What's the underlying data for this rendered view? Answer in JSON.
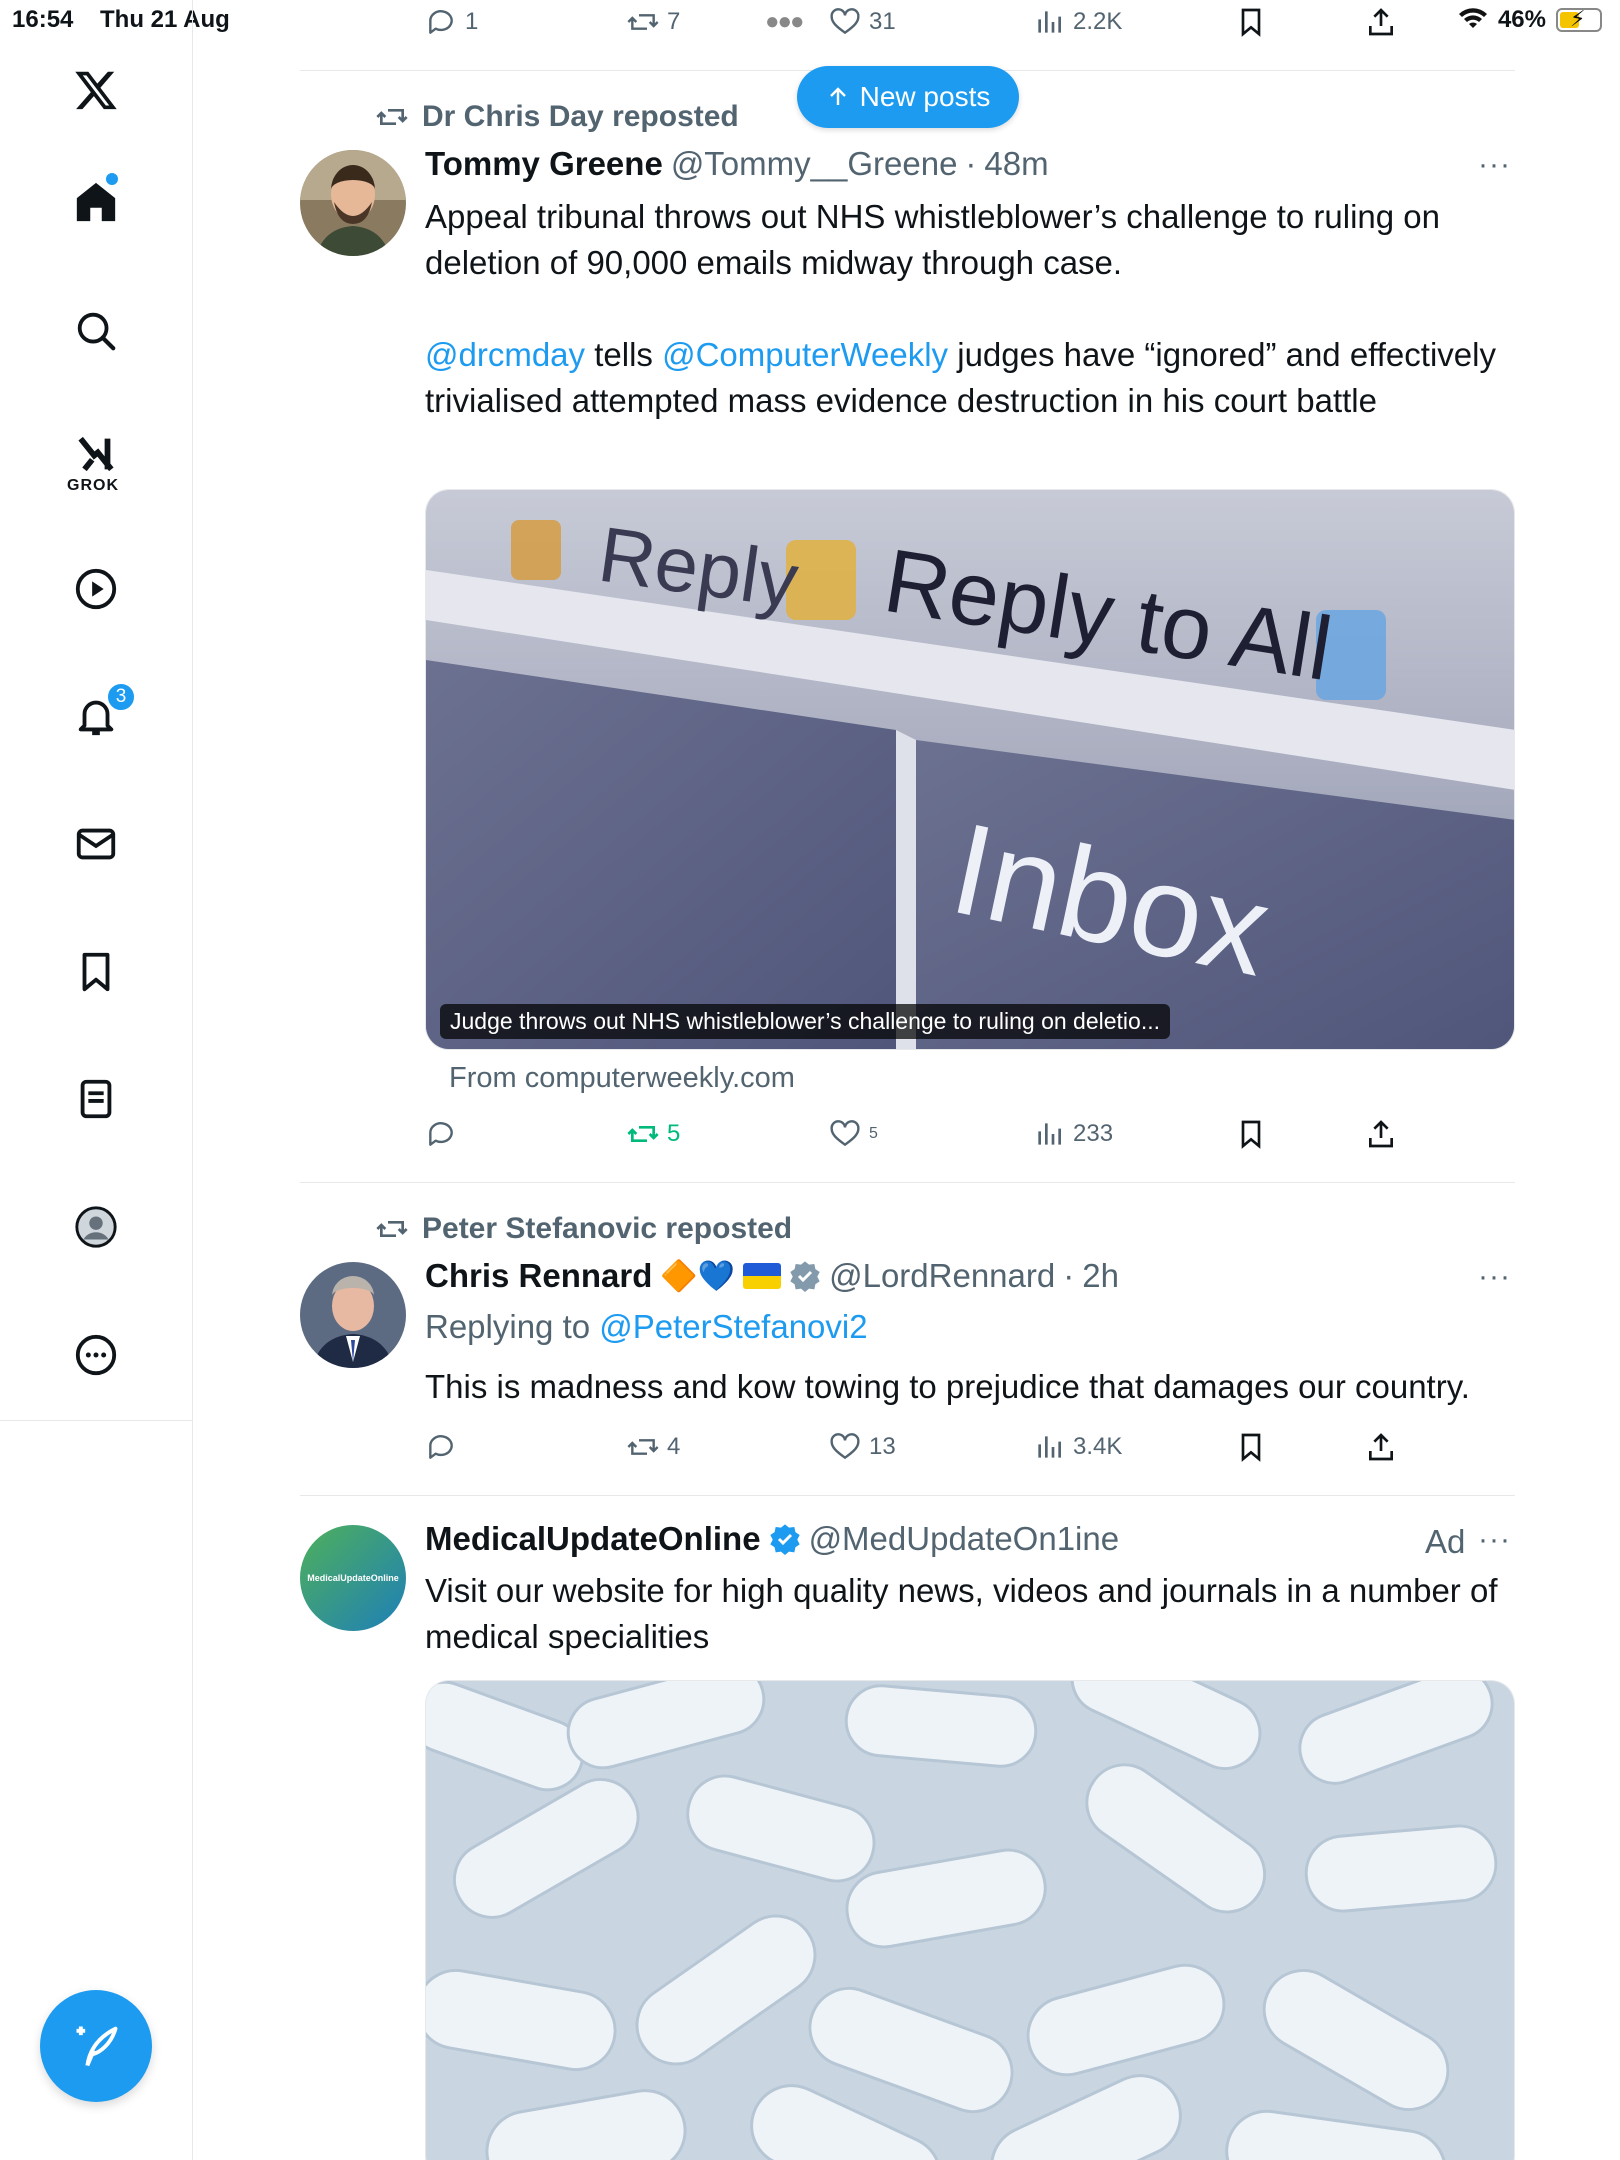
{
  "status_bar": {
    "time": "16:54",
    "date": "Thu 21 Aug",
    "battery": "46%"
  },
  "sidebar": {
    "items": [
      {
        "icon": "x-logo-icon"
      },
      {
        "icon": "home-icon"
      },
      {
        "icon": "search-icon"
      },
      {
        "icon": "grok-icon",
        "label": "GROK"
      },
      {
        "icon": "video-play-icon"
      },
      {
        "icon": "notifications-bell-icon",
        "badge": "3"
      },
      {
        "icon": "messages-envelope-icon"
      },
      {
        "icon": "bookmarks-icon"
      },
      {
        "icon": "lists-icon"
      },
      {
        "icon": "profile-icon"
      },
      {
        "icon": "more-options-icon"
      }
    ],
    "compose_icon": "compose-post-icon"
  },
  "top_partial_post": {
    "actions": {
      "replies": "1",
      "reposts": "7",
      "likes": "31",
      "views": "2.2K"
    }
  },
  "new_posts_button": {
    "label": "New posts"
  },
  "posts": [
    {
      "repost_by": "Dr Chris Day reposted",
      "name": "Tommy Greene",
      "handle": "@Tommy__Greene",
      "dot": "·",
      "time": "48m",
      "more": "···",
      "text_1": "Appeal tribunal throws out NHS whistleblower’s challenge to ruling on deletion of 90,000 emails midway through case.",
      "mention_1": "@drcmday",
      "text_2": " tells ",
      "mention_2": "@ComputerWeekly",
      "text_3": " judges have “ignored” and effectively trivialised attempted mass evidence destruction in his court battle",
      "card": {
        "image_words": [
          "Reply",
          "Reply to All",
          "Inbox"
        ],
        "caption": "Judge throws out NHS whistleblower’s challenge to ruling on deletio...",
        "source": "From computerweekly.com"
      },
      "actions": {
        "replies": "",
        "reposts": "5",
        "likes": "5",
        "views": "233"
      },
      "repost_color": "#00ba7c"
    },
    {
      "repost_by": "Peter Stefanovic reposted",
      "name": "Chris Rennard",
      "emoji": "🔶💙",
      "handle": "@LordRennard",
      "dot": "·",
      "time": "2h",
      "more": "···",
      "replying_prefix": "Replying to ",
      "replying_to": "@PeterStefanovi2",
      "text": "This is madness and kow towing to prejudice that damages our country.",
      "actions": {
        "replies": "",
        "reposts": "4",
        "likes": "13",
        "views": "3.4K"
      }
    },
    {
      "name": "MedicalUpdateOnline",
      "handle": "@MedUpdateOn1ine",
      "ad": "Ad",
      "more": "···",
      "avatar_text": "MedicalUpdateOnline",
      "text": "Visit our website for high quality news, videos and journals in a number of medical specialities"
    }
  ],
  "colors": {
    "accent": "#1d9bf0",
    "muted": "#536471",
    "repost_green": "#00ba7c",
    "text": "#0f1419"
  }
}
